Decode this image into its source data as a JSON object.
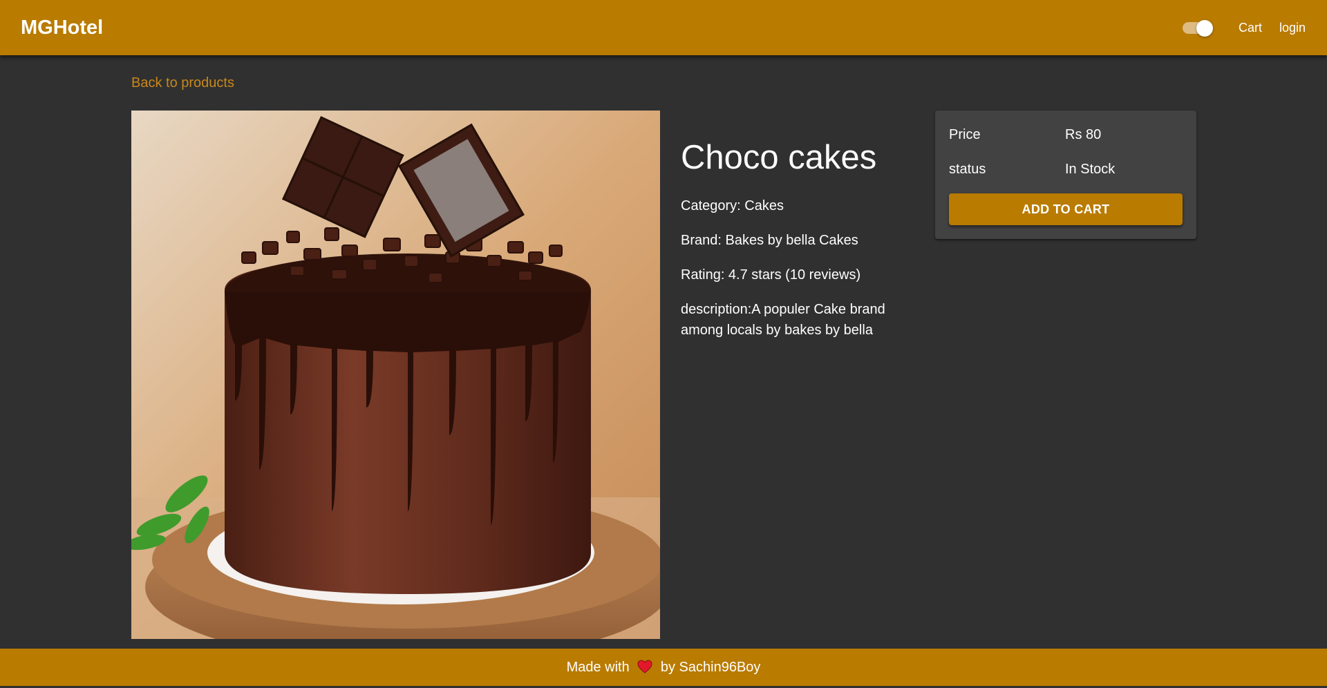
{
  "header": {
    "brand": "MGHotel",
    "theme_toggle_on": true,
    "nav": {
      "cart_label": "Cart",
      "login_label": "login"
    }
  },
  "back_link": "Back to products",
  "product": {
    "image_subject": "chocolate drip cake",
    "title": "Choco cakes",
    "category": "Category: Cakes",
    "brand": "Brand: Bakes by bella Cakes",
    "rating": "Rating: 4.7 stars (10 reviews)",
    "description": "description:A populer Cake brand among locals by bakes by bella"
  },
  "purchase_card": {
    "price_label": "Price",
    "price_value": "Rs 80",
    "status_label": "status",
    "status_value": "In Stock",
    "add_to_cart_label": "ADD TO CART"
  },
  "footer": {
    "text_before": "Made with",
    "heart_icon": "heart-icon",
    "text_after": "by Sachin96Boy"
  },
  "colors": {
    "accent": "#b97b00",
    "background": "#303030",
    "card": "#424242",
    "link": "#c9881a"
  }
}
